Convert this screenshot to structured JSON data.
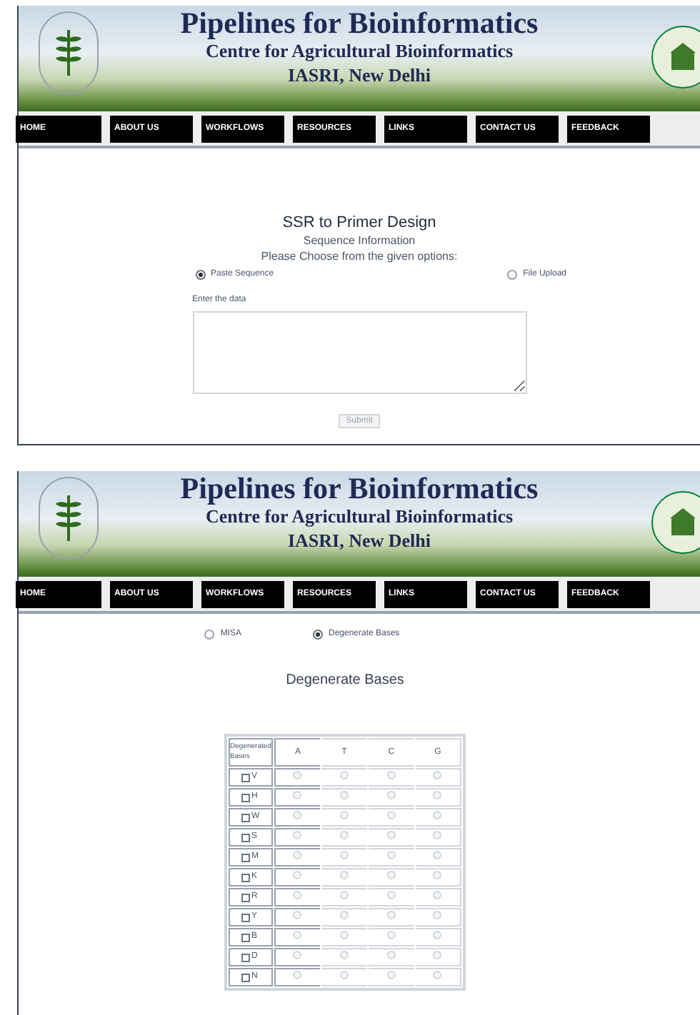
{
  "panels": [
    {
      "kind": "sequence_form",
      "banner": {
        "title": "Pipelines for Bioinformatics",
        "subtitle": "Centre for Agricultural Bioinformatics",
        "institute": "IASRI, New Delhi"
      },
      "nav": [
        "HOME",
        "ABOUT US",
        "WORKFLOWS",
        "RESOURCES",
        "LINKS",
        "CONTACT US",
        "FEEDBACK"
      ],
      "heading": "SSR to Primer Design",
      "subheading": "Sequence Information",
      "prompt": "Please Choose from the given options:",
      "options": [
        {
          "label": "Paste Sequence",
          "selected": true
        },
        {
          "label": "File Upload",
          "selected": false
        }
      ],
      "field_label": "Enter the data",
      "submit": "Submit"
    },
    {
      "kind": "degenerate_bases",
      "banner": {
        "title": "Pipelines for Bioinformatics",
        "subtitle": "Centre for Agricultural Bioinformatics",
        "institute": "IASRI, New Delhi"
      },
      "nav": [
        "HOME",
        "ABOUT US",
        "WORKFLOWS",
        "RESOURCES",
        "LINKS",
        "CONTACT US",
        "FEEDBACK"
      ],
      "options": [
        {
          "label": "MISA",
          "selected": false
        },
        {
          "label": "Degenerate Bases",
          "selected": true
        }
      ],
      "heading": "Degenerate Bases",
      "table": {
        "columns": [
          "Degenerated Bases",
          "A",
          "T",
          "C",
          "G"
        ],
        "rows": [
          {
            "base": "V",
            "checked": false,
            "choices": [
              {
                "selected": false
              },
              {
                "selected": false
              },
              {
                "selected": false
              },
              {
                "selected": false
              }
            ]
          },
          {
            "base": "H",
            "checked": false,
            "choices": [
              {
                "selected": false
              },
              {
                "selected": false
              },
              {
                "selected": false
              },
              {
                "selected": false
              }
            ]
          },
          {
            "base": "W",
            "checked": false,
            "choices": [
              {
                "selected": false
              },
              {
                "selected": false
              },
              {
                "selected": false
              },
              {
                "selected": false
              }
            ]
          },
          {
            "base": "S",
            "checked": false,
            "choices": [
              {
                "selected": false
              },
              {
                "selected": false
              },
              {
                "selected": false
              },
              {
                "selected": false
              }
            ]
          },
          {
            "base": "M",
            "checked": false,
            "choices": [
              {
                "selected": false
              },
              {
                "selected": false
              },
              {
                "selected": false
              },
              {
                "selected": false
              }
            ]
          },
          {
            "base": "K",
            "checked": false,
            "choices": [
              {
                "selected": false
              },
              {
                "selected": false
              },
              {
                "selected": false
              },
              {
                "selected": false
              }
            ]
          },
          {
            "base": "R",
            "checked": false,
            "choices": [
              {
                "selected": false
              },
              {
                "selected": false
              },
              {
                "selected": false
              },
              {
                "selected": false
              }
            ]
          },
          {
            "base": "Y",
            "checked": false,
            "choices": [
              {
                "selected": false
              },
              {
                "selected": false
              },
              {
                "selected": false
              },
              {
                "selected": false
              }
            ]
          },
          {
            "base": "B",
            "checked": false,
            "choices": [
              {
                "selected": false
              },
              {
                "selected": false
              },
              {
                "selected": false
              },
              {
                "selected": false
              }
            ]
          },
          {
            "base": "D",
            "checked": false,
            "choices": [
              {
                "selected": false
              },
              {
                "selected": false
              },
              {
                "selected": false
              },
              {
                "selected": false
              }
            ]
          },
          {
            "base": "N",
            "checked": false,
            "choices": [
              {
                "selected": false
              },
              {
                "selected": false
              },
              {
                "selected": false
              },
              {
                "selected": false
              }
            ]
          }
        ]
      }
    }
  ]
}
